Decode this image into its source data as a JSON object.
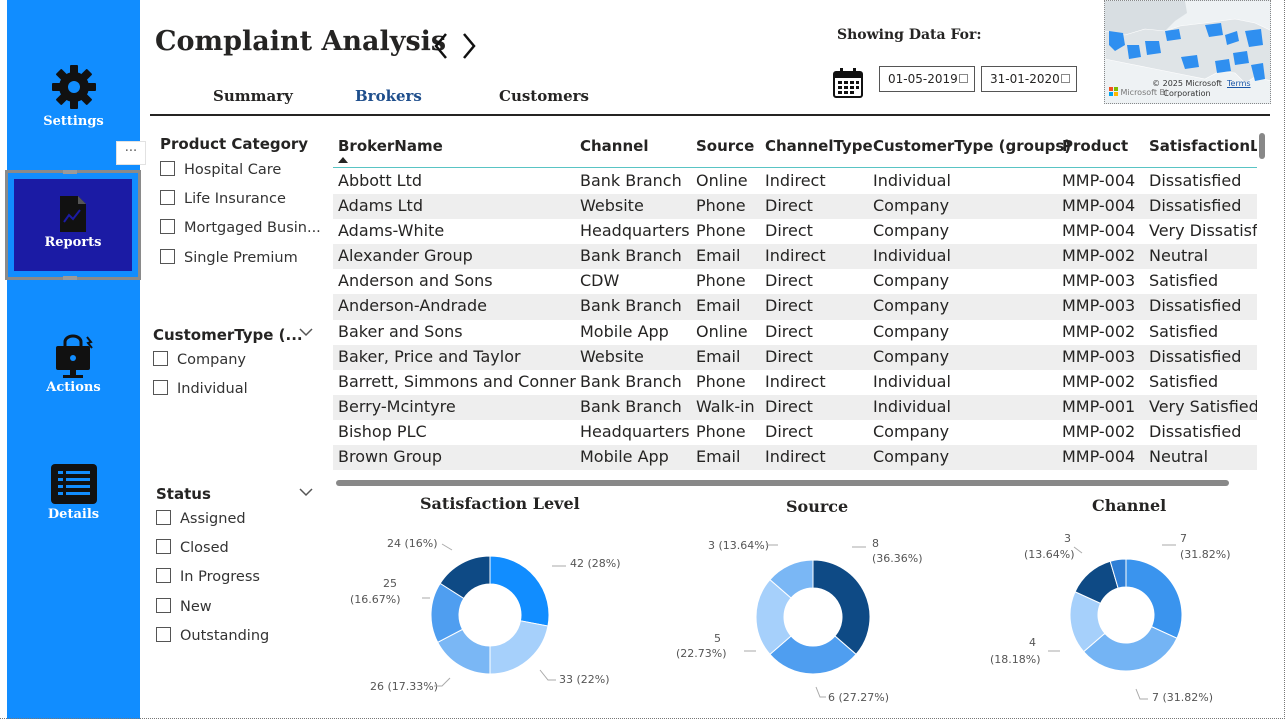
{
  "sidebar": {
    "settings_label": "Settings",
    "reports_label": "Reports",
    "actions_label": "Actions",
    "details_label": "Details",
    "more_label": "···"
  },
  "header": {
    "title": "Complaint Analysis",
    "tabs": [
      "Summary",
      "Brokers",
      "Customers"
    ],
    "showing_label": "Showing Data For:",
    "date_from": "01-05-2019",
    "date_to": "31-01-2020"
  },
  "map": {
    "credit": "© 2025 Microsoft Corporation",
    "terms": "Terms",
    "brand": "Microsoft Bi"
  },
  "slicers": {
    "product": {
      "title": "Product Category",
      "items": [
        "Hospital Care",
        "Life Insurance",
        "Mortgaged Busin...",
        "Single Premium"
      ]
    },
    "customer_type": {
      "title": "CustomerType (...",
      "items": [
        "Company",
        "Individual"
      ]
    },
    "status": {
      "title": "Status",
      "items": [
        "Assigned",
        "Closed",
        "In Progress",
        "New",
        "Outstanding"
      ]
    }
  },
  "table": {
    "columns": [
      "BrokerName",
      "Channel",
      "Source",
      "ChannelType",
      "CustomerType (groups)",
      "Product",
      "SatisfactionLe"
    ],
    "rows": [
      [
        "Abbott Ltd",
        "Bank Branch",
        "Online",
        "Indirect",
        "Individual",
        "MMP-004",
        "Dissatisfied"
      ],
      [
        "Adams Ltd",
        "Website",
        "Phone",
        "Direct",
        "Company",
        "MMP-004",
        "Dissatisfied"
      ],
      [
        "Adams-White",
        "Headquarters",
        "Phone",
        "Direct",
        "Company",
        "MMP-004",
        "Very Dissatisfi"
      ],
      [
        "Alexander Group",
        "Bank Branch",
        "Email",
        "Indirect",
        "Individual",
        "MMP-002",
        "Neutral"
      ],
      [
        "Anderson and Sons",
        "CDW",
        "Phone",
        "Direct",
        "Company",
        "MMP-003",
        "Satisfied"
      ],
      [
        "Anderson-Andrade",
        "Bank Branch",
        "Email",
        "Direct",
        "Company",
        "MMP-003",
        "Dissatisfied"
      ],
      [
        "Baker and Sons",
        "Mobile App",
        "Online",
        "Direct",
        "Company",
        "MMP-002",
        "Satisfied"
      ],
      [
        "Baker, Price and Taylor",
        "Website",
        "Email",
        "Direct",
        "Company",
        "MMP-003",
        "Dissatisfied"
      ],
      [
        "Barrett, Simmons and Conner",
        "Bank Branch",
        "Phone",
        "Indirect",
        "Individual",
        "MMP-002",
        "Satisfied"
      ],
      [
        "Berry-Mcintyre",
        "Bank Branch",
        "Walk-in",
        "Direct",
        "Individual",
        "MMP-001",
        "Very Satisfied"
      ],
      [
        "Bishop PLC",
        "Headquarters",
        "Phone",
        "Direct",
        "Company",
        "MMP-002",
        "Dissatisfied"
      ],
      [
        "Brown Group",
        "Mobile App",
        "Email",
        "Indirect",
        "Company",
        "MMP-004",
        "Neutral"
      ]
    ]
  },
  "charts": {
    "satisfaction": {
      "title": "Satisfaction Level",
      "labels": [
        "42 (28%)",
        "33 (22%)",
        "26 (17.33%)",
        "25",
        "(16.67%)",
        "24 (16%)"
      ]
    },
    "source": {
      "title": "Source",
      "labels": [
        "8",
        "(36.36%)",
        "6 (27.27%)",
        "5",
        "(22.73%)",
        "3 (13.64%)"
      ]
    },
    "channel": {
      "title": "Channel",
      "labels": [
        "7",
        "(31.82%)",
        "7 (31.82%)",
        "4",
        "(18.18%)",
        "3",
        "(13.64%)"
      ]
    }
  },
  "chart_data": [
    {
      "type": "pie",
      "title": "Satisfaction Level",
      "values": [
        42,
        33,
        26,
        25,
        24
      ],
      "percents": [
        28,
        22,
        17.33,
        16.67,
        16
      ],
      "colors": [
        "#118dff",
        "#a6d0fb",
        "#7ab7f5",
        "#4f9ef0",
        "#0e4a85"
      ]
    },
    {
      "type": "pie",
      "title": "Source",
      "values": [
        8,
        6,
        5,
        3
      ],
      "percents": [
        36.36,
        27.27,
        22.73,
        13.64
      ],
      "colors": [
        "#0e4a85",
        "#4f9ef0",
        "#a6d0fb",
        "#7ab7f5"
      ]
    },
    {
      "type": "pie",
      "title": "Channel",
      "values": [
        7,
        7,
        4,
        3,
        1
      ],
      "percents": [
        31.82,
        31.82,
        18.18,
        13.64,
        4.55
      ],
      "colors": [
        "#3a94ee",
        "#74b4f4",
        "#a6d0fb",
        "#0e4a85",
        "#2f7fd6"
      ]
    }
  ]
}
